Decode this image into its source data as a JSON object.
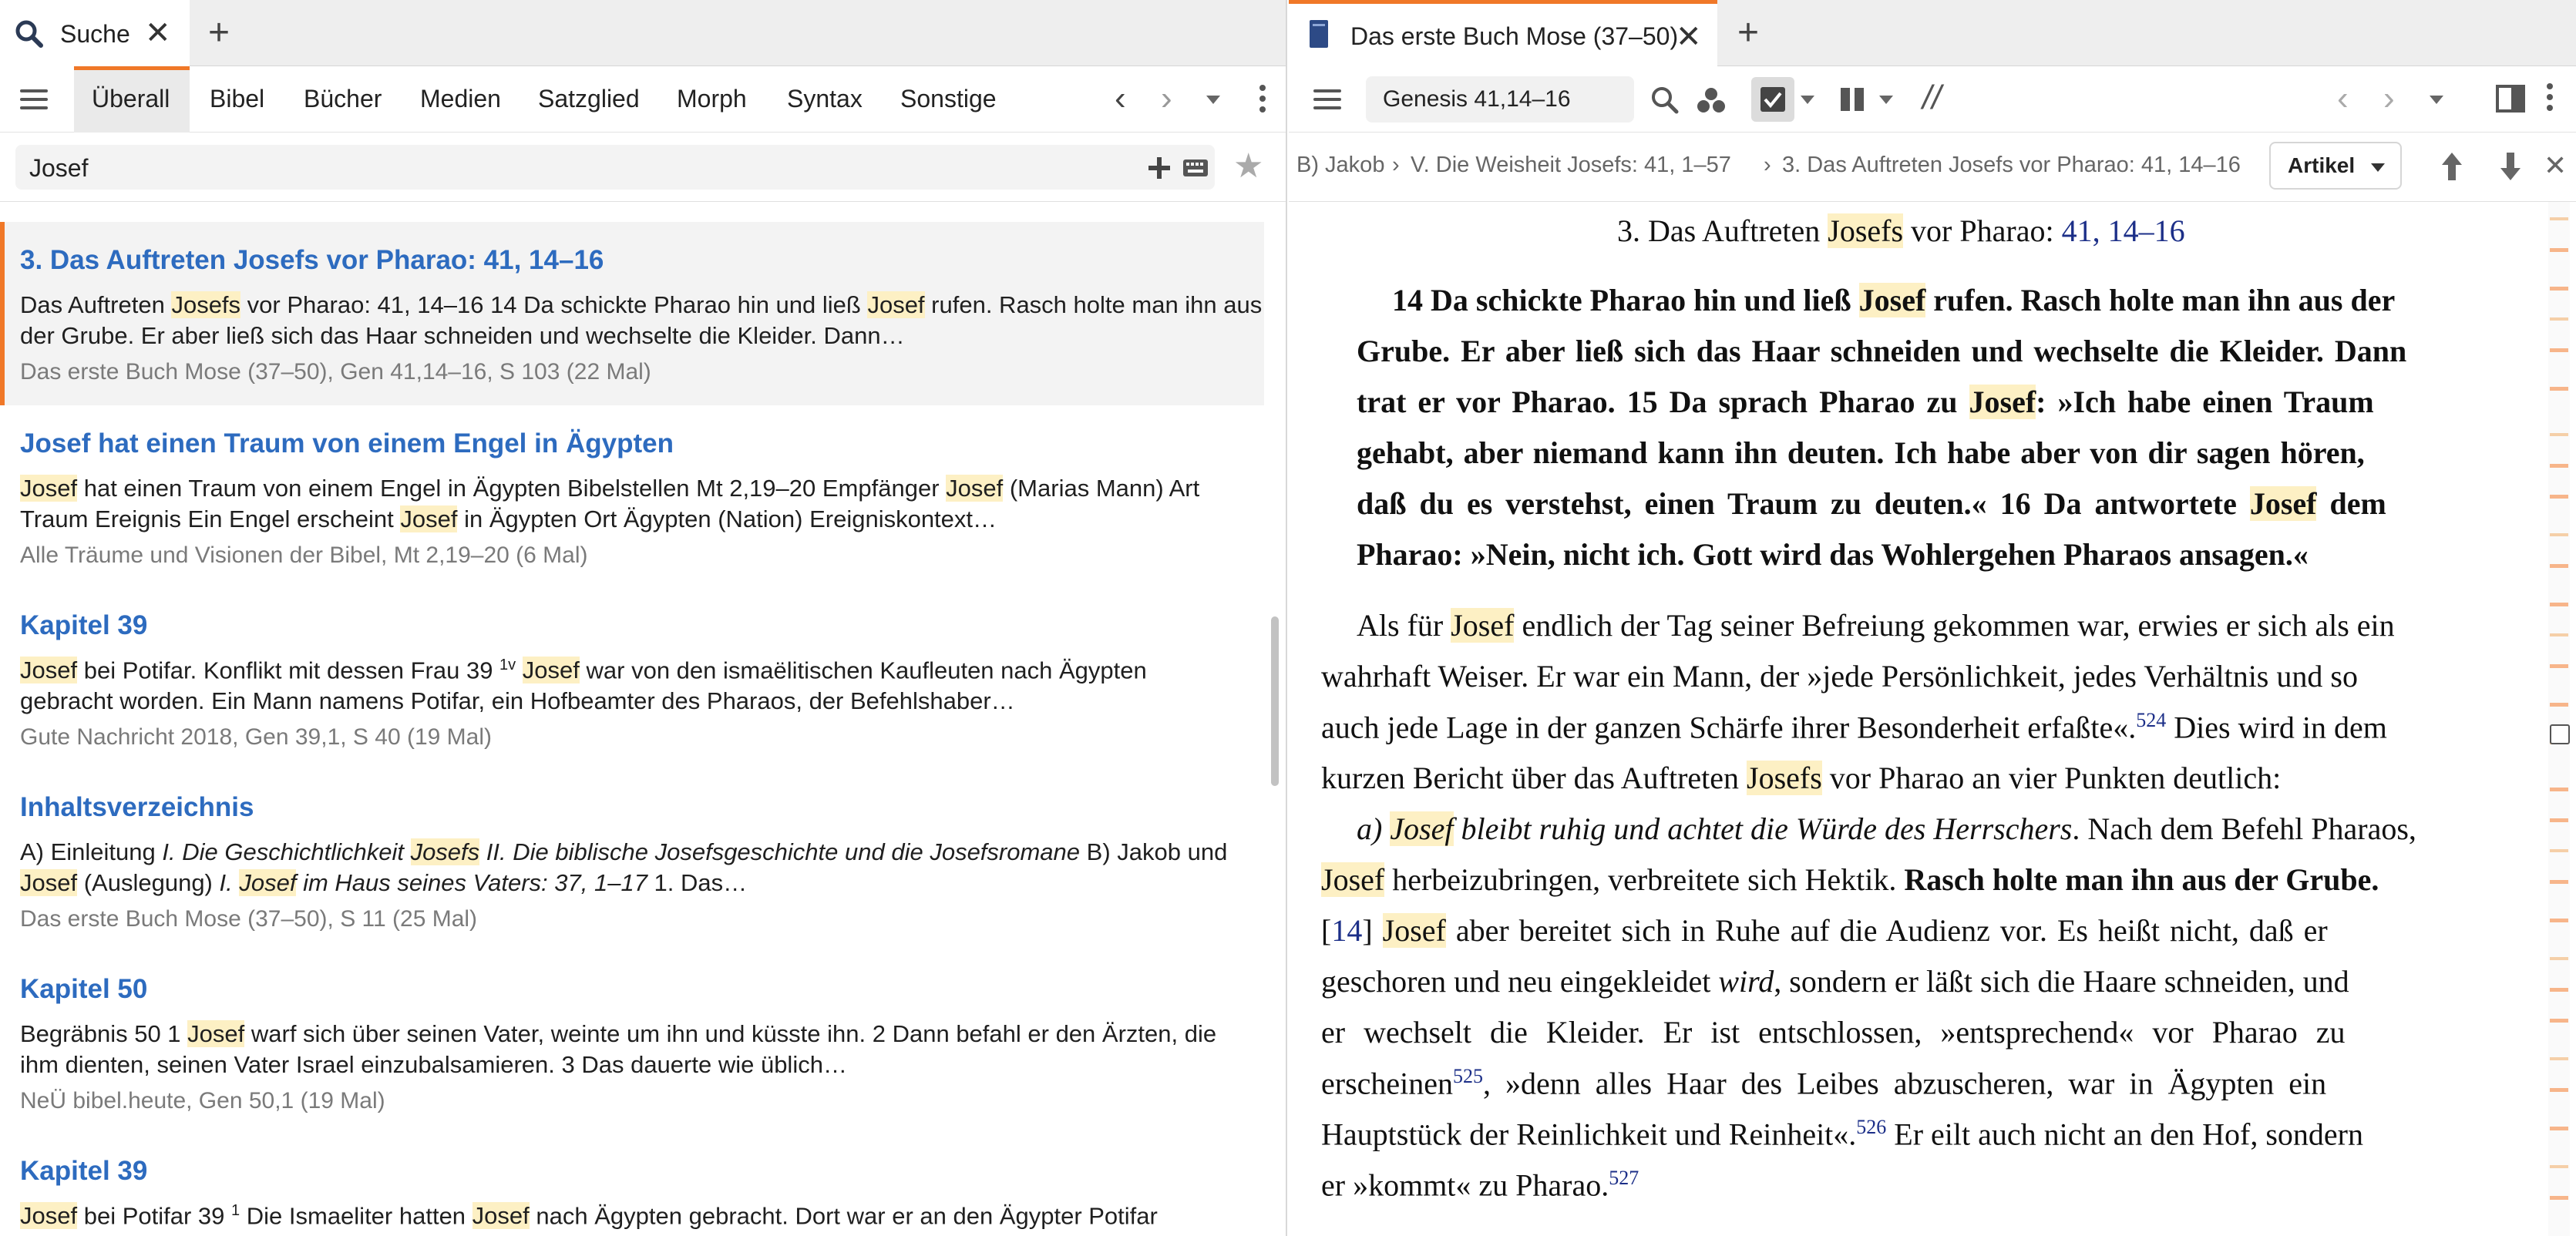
{
  "left": {
    "tab": {
      "label": "Suche"
    },
    "search_tabs": [
      "Überall",
      "Bibel",
      "Bücher",
      "Medien",
      "Satzglied",
      "Morph",
      "Syntax",
      "Sonstige"
    ],
    "query": "Josef",
    "results": [
      {
        "title": "3. Das Auftreten Josefs vor Pharao: 41, 14–16",
        "line1": [
          "Das Auftreten ",
          "Josefs",
          " vor Pharao: 41, 14–16 14 Da schickte Pharao hin und ließ ",
          "Josef",
          " rufen. Rasch holte man ihn aus"
        ],
        "line2": [
          "der Grube. Er aber ließ sich das Haar schneiden und wechselte die Kleider. Dann…"
        ],
        "source": "Das erste Buch Mose (37–50), Gen 41,14–16, S 103 (22 Mal)"
      },
      {
        "title": "Josef hat einen Traum von einem Engel in Ägypten",
        "line1": [
          "Josef",
          " hat einen Traum von einem Engel in Ägypten Bibelstellen Mt 2,19–20 Empfänger ",
          "Josef",
          " (Marias Mann) Art"
        ],
        "line2": [
          "Traum Ereignis Ein Engel erscheint ",
          "Josef",
          " in Ägypten Ort Ägypten (Nation) Ereigniskontext…"
        ],
        "source": "Alle Träume und Visionen der Bibel, Mt 2,19–20 (6 Mal)"
      },
      {
        "title": "Kapitel 39",
        "line1": [
          "Josef",
          " bei Potifar. Konflikt mit dessen Frau 39 ",
          "1v",
          " ",
          "Josef",
          " war von den ismaëlitischen Kaufleuten nach Ägypten"
        ],
        "line2": [
          "gebracht worden. Ein Mann namens Potifar, ein Hofbeamter des Pharaos, der Befehlshaber…"
        ],
        "source": "Gute Nachricht 2018, Gen 39,1, S 40 (19 Mal)"
      },
      {
        "title": "Inhaltsverzeichnis",
        "line1": [
          "A) Einleitung ",
          "I. Die Geschichtlichkeit ",
          "Josefs",
          " II. Die biblische Josefsgeschichte und die Josefsromane",
          " B) Jakob und"
        ],
        "line2": [
          "Josef",
          " (Auslegung) ",
          "I. ",
          "Josef",
          " im Haus seines Vaters: 37, 1–17",
          " 1. Das…"
        ],
        "source": "Das erste Buch Mose (37–50), S 11 (25 Mal)"
      },
      {
        "title": "Kapitel 50",
        "line1": [
          "Begräbnis 50 1 ",
          "Josef",
          " warf sich über seinen Vater, weinte um ihn und küsste ihn. 2 Dann befahl er den Ärzten, die"
        ],
        "line2": [
          "ihm dienten, seinen Vater Israel einzubalsamieren. 3 Das dauerte wie üblich…"
        ],
        "source": "NeÜ bibel.heute, Gen 50,1 (19 Mal)"
      },
      {
        "title": "Kapitel 39",
        "line1": [
          "Josef",
          " bei Potifar 39 ",
          "1",
          " Die Ismaeliter hatten ",
          "Josef",
          " nach Ägypten gebracht. Dort war er an den Ägypter Potifar"
        ],
        "line2": [],
        "source": ""
      }
    ]
  },
  "right": {
    "tab": {
      "label": "Das erste Buch Mose (37–50)"
    },
    "reference": "Genesis 41,14–16",
    "breadcrumb": [
      "B) Jakob",
      "V. Die Weisheit Josefs: 41, 1–57",
      "3. Das Auftreten Josefs vor Pharao: 41, 14–16"
    ],
    "artikel_label": "Artikel",
    "heading": [
      "3. Das Auftreten ",
      "Josefs",
      " vor Pharao: ",
      "41, 14–16"
    ],
    "bold_lines": [
      [
        "14 Da schickte Pharao hin und ließ ",
        "Josef",
        " rufen. Rasch holte man ihn aus der"
      ],
      [
        "Grube. Er aber ließ sich das Haar schneiden und wechselte die Kleider. Dann"
      ],
      [
        "trat er vor Pharao. 15 Da sprach Pharao zu ",
        "Josef",
        ": »Ich habe einen Traum"
      ],
      [
        "gehabt, aber niemand kann ihn deuten. Ich habe aber von dir sagen hören,"
      ],
      [
        "daß du es verstehst, einen Traum zu deuten.« 16 Da antwortete ",
        "Josef",
        " dem"
      ],
      [
        "Pharao: »Nein, nicht ich. Gott wird das Wohlergehen Pharaos ansagen.«"
      ]
    ],
    "body_lines": [
      [
        "Als für ",
        "Josef",
        " endlich der Tag seiner Befreiung gekommen war, erwies er sich als ein"
      ],
      [
        "wahrhaft Weiser. Er war ein Mann, der »jede Persönlichkeit, jedes Verhältnis und so"
      ],
      [
        "auch jede Lage in der ganzen Schärfe ihrer Besonderheit erfaßte«.",
        "524",
        " Dies wird in dem"
      ],
      [
        "kurzen Bericht über das Auftreten ",
        "Josefs",
        " vor Pharao an vier Punkten deutlich:"
      ],
      [
        "a) ",
        "Josef",
        " bleibt ruhig und achtet die Würde des Herrschers",
        ". Nach dem Befehl Pharaos,"
      ],
      [
        "Josef",
        " herbeizubringen, verbreitete sich Hektik. ",
        "Rasch holte man ihn aus der Grube."
      ],
      [
        "[",
        "14",
        "] ",
        "Josef",
        " aber bereitet sich in Ruhe auf die Audienz vor. Es heißt nicht, daß er"
      ],
      [
        "geschoren und neu eingekleidet ",
        "wird",
        ", sondern er läßt sich die Haare schneiden, und"
      ],
      [
        "er wechselt die Kleider. Er ist entschlossen, »entsprechend« vor Pharao zu"
      ],
      [
        "erscheinen",
        "525",
        ", »denn alles Haar des Leibes abzuscheren, war in Ägypten ein"
      ],
      [
        "Hauptstück der Reinlichkeit und Reinheit«.",
        "526",
        " Er eilt auch nicht an den Hof, sondern"
      ],
      [
        "er »kommt« zu Pharao.",
        "527"
      ]
    ]
  },
  "colors": {
    "accent": "#f07828",
    "link": "#2d6bbf",
    "highlight": "#fdf0c4",
    "verse_ref": "#1c2f88"
  }
}
